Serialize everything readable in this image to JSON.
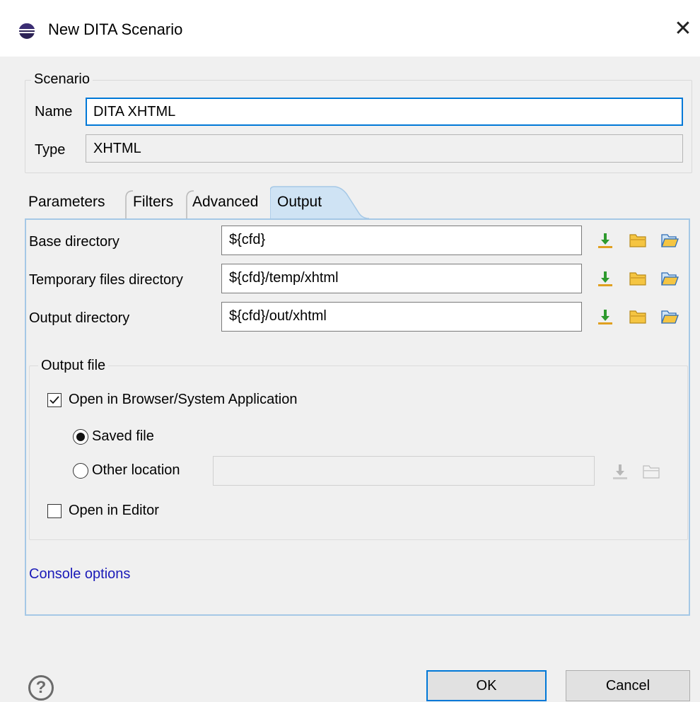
{
  "window": {
    "title": "New DITA Scenario",
    "close_symbol": "✕",
    "icon": "eclipse-globe-icon"
  },
  "scenario": {
    "legend": "Scenario",
    "name_label": "Name",
    "name_value": "DITA XHTML",
    "type_label": "Type",
    "type_value": "XHTML"
  },
  "tabs": [
    {
      "label": "Parameters",
      "active": false
    },
    {
      "label": "Filters",
      "active": false
    },
    {
      "label": "Advanced",
      "active": false
    },
    {
      "label": "Output",
      "active": true
    }
  ],
  "output": {
    "rows": [
      {
        "label": "Base directory",
        "value": "${cfd}"
      },
      {
        "label": "Temporary files directory",
        "value": "${cfd}/temp/xhtml"
      },
      {
        "label": "Output directory",
        "value": "${cfd}/out/xhtml"
      }
    ],
    "output_file": {
      "legend": "Output file",
      "open_in_browser": {
        "label": "Open in Browser/System Application",
        "checked": true
      },
      "saved_file": {
        "label": "Saved file",
        "selected": true
      },
      "other_location": {
        "label": "Other location",
        "selected": false,
        "value": ""
      },
      "open_in_editor": {
        "label": "Open in Editor",
        "checked": false
      }
    },
    "console_options_link": "Console options"
  },
  "icons": {
    "insert_variable": "insert-editor-variable-icon",
    "browse_local": "folder-icon",
    "browse_workspace": "open-folder-icon",
    "help": "help-icon"
  },
  "colors": {
    "accent": "#0078d7",
    "link": "#1a1ab8",
    "folder_yellow": "#f5c542",
    "download_green": "#2e9a2e",
    "tab_active": "#cfe3f4"
  },
  "buttons": {
    "help_symbol": "?",
    "ok": "OK",
    "cancel": "Cancel"
  }
}
